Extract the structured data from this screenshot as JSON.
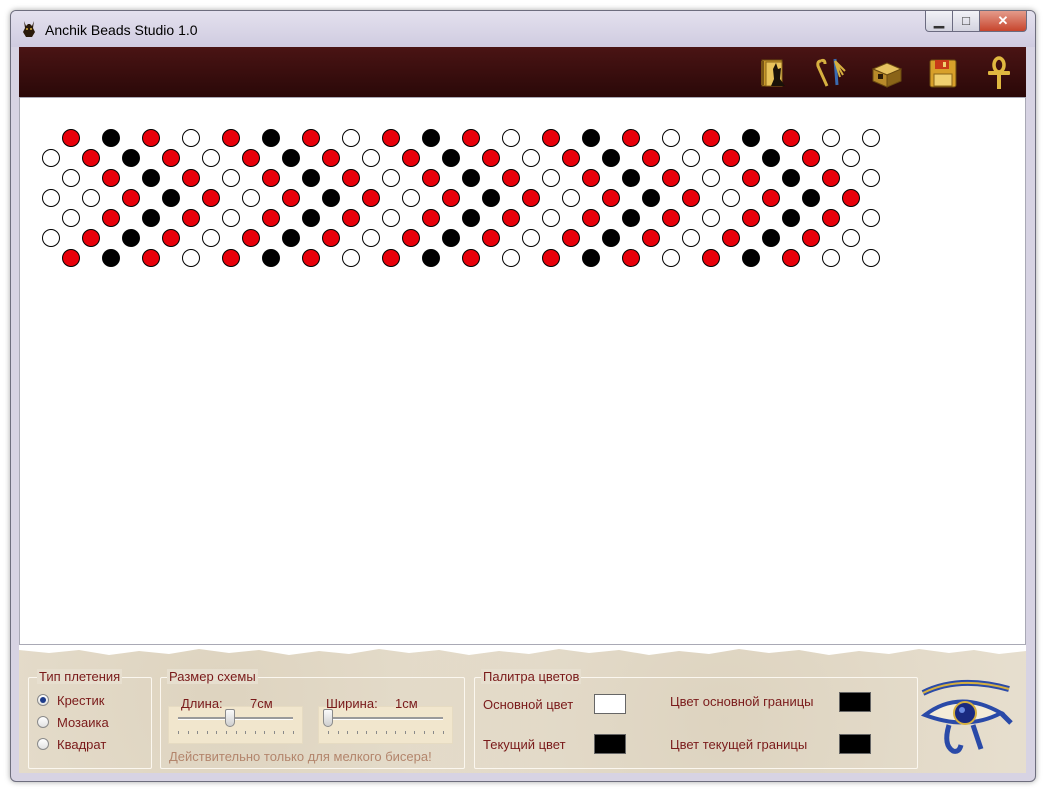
{
  "window": {
    "title": "Anchik Beads Studio 1.0"
  },
  "titlebar_buttons": {
    "minimize": "▁",
    "maximize": "□",
    "close": "✕"
  },
  "toolbar": {
    "buttons": [
      {
        "name": "anubis-book-icon"
      },
      {
        "name": "crook-flail-icon"
      },
      {
        "name": "treasure-chest-icon"
      },
      {
        "name": "floppy-disk-icon"
      },
      {
        "name": "ankh-icon"
      }
    ]
  },
  "bead_colors": {
    "r": "#e8000a",
    "k": "#000000",
    "w": "#ffffff"
  },
  "bead_pattern": {
    "rows": [
      "rkrwrkrwrkrwrkrwrkrww",
      "wrkrwrkrwrkrwrkrwrkrw",
      "wrkrwrkrwrkrwrkrwrkrw",
      "wwrkrwrkrwrkrwrkrwrkr",
      "wrkrwrkrwrkrwrkrwrkrw",
      "wrkrwrkrwrkrwrkrwrkrw",
      "rkrwrkrwrkrwrkrwrkrww"
    ]
  },
  "weave_type": {
    "title": "Тип плетения",
    "options": [
      {
        "label": "Крестик",
        "checked": true
      },
      {
        "label": "Мозаика",
        "checked": false
      },
      {
        "label": "Квадрат",
        "checked": false
      }
    ]
  },
  "scheme_size": {
    "title": "Размер схемы",
    "length_label": "Длина:",
    "length_value": "7см",
    "length_fraction": 0.45,
    "width_label": "Ширина:",
    "width_value": "1см",
    "width_fraction": 0.0,
    "note": "Действительно только для мелкого бисера!"
  },
  "palette": {
    "title": "Палитра цветов",
    "main_color_label": "Основной цвет",
    "main_color": "#ffffff",
    "current_color_label": "Текущий цвет",
    "current_color": "#000000",
    "main_border_label": "Цвет основной границы",
    "main_border_color": "#000000",
    "current_border_label": "Цвет текущей границы",
    "current_border_color": "#000000"
  },
  "decor": {
    "icon": "eye-of-horus-icon"
  }
}
